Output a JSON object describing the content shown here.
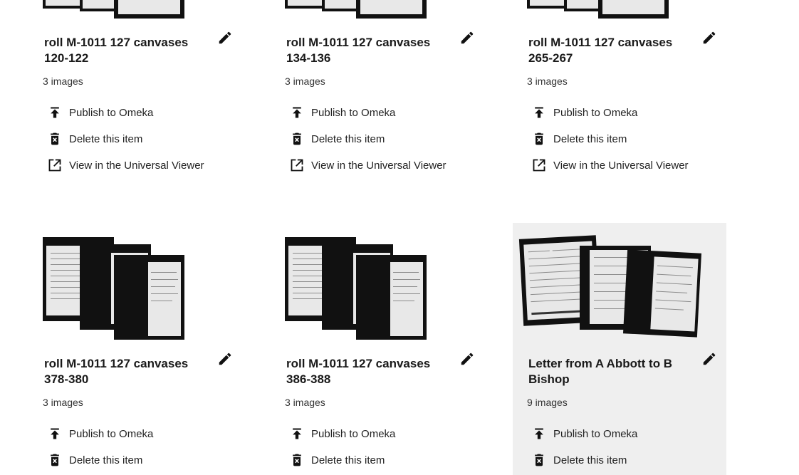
{
  "actions": {
    "publish": "Publish to Omeka",
    "delete": "Delete this item",
    "viewer": "View in the Universal Viewer"
  },
  "items": [
    {
      "title": "roll M-1011 127 canvases 120-122",
      "count": "3 images"
    },
    {
      "title": "roll M-1011 127 canvases 134-136",
      "count": "3 images"
    },
    {
      "title": "roll M-1011 127 canvases 265-267",
      "count": "3 images"
    },
    {
      "title": "roll M-1011 127 canvases 378-380",
      "count": "3 images"
    },
    {
      "title": "roll M-1011 127 canvases 386-388",
      "count": "3 images"
    },
    {
      "title": "Letter from A Abbott to B Bishop",
      "count": "9 images"
    }
  ],
  "icons": [
    "pencil-icon",
    "publish-icon",
    "trash-icon",
    "external-link-icon"
  ],
  "colors": {
    "highlight_bg": "#efefef",
    "text": "#1f1f1f",
    "icon": "#111111"
  }
}
